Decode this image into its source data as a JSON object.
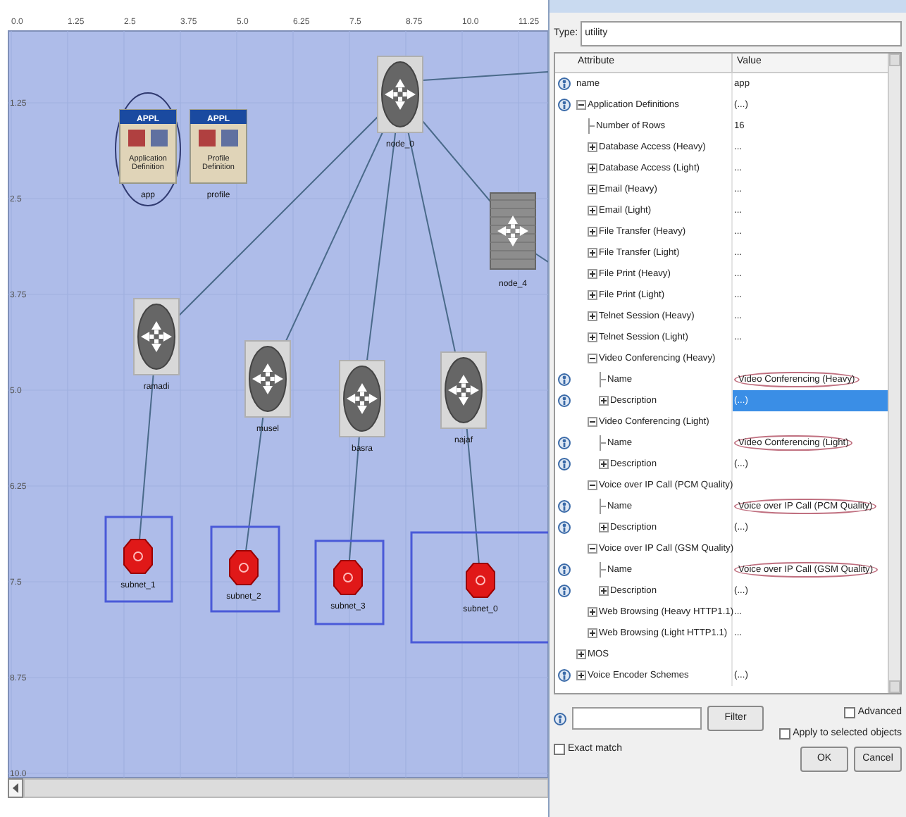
{
  "canvas": {
    "x_ruler": [
      "0.0",
      "1.25",
      "2.5",
      "3.75",
      "5.0",
      "6.25",
      "7.5",
      "8.75",
      "10.0",
      "11.25"
    ],
    "y_ruler": [
      "1.25",
      "2.5",
      "3.75",
      "5.0",
      "6.25",
      "7.5",
      "8.75",
      "10.0"
    ],
    "nodes": [
      {
        "kind": "config",
        "badge": "APPL",
        "caption": "Application Definition",
        "label": "app",
        "circled": true
      },
      {
        "kind": "config",
        "badge": "APPL",
        "caption": "Profile Definition",
        "label": "profile",
        "circled": false
      },
      {
        "kind": "router",
        "label": "node_0"
      },
      {
        "kind": "switch",
        "label": "node_4"
      },
      {
        "kind": "router",
        "label": "ramadi"
      },
      {
        "kind": "router",
        "label": "musel"
      },
      {
        "kind": "router",
        "label": "basra"
      },
      {
        "kind": "router",
        "label": "najaf"
      },
      {
        "kind": "subnet",
        "label": "subnet_1"
      },
      {
        "kind": "subnet",
        "label": "subnet_2"
      },
      {
        "kind": "subnet",
        "label": "subnet_3"
      },
      {
        "kind": "subnet",
        "label": "subnet_0"
      }
    ]
  },
  "dialog": {
    "type_label": "Type:",
    "type_value": "utility",
    "columns": [
      "Attribute",
      "Value"
    ],
    "attributes": [
      {
        "name": "name",
        "value": "app",
        "info": true,
        "selected": false
      },
      {
        "name": "Application Definitions",
        "value": "(...)",
        "info": true,
        "expanded": true,
        "selected": false,
        "children": [
          {
            "name": "Number of Rows",
            "value": "16",
            "info": false,
            "selected": false
          },
          {
            "name": "Database Access (Heavy)",
            "value": "...",
            "info": false,
            "expanded": false,
            "selected": false
          },
          {
            "name": "Database Access (Light)",
            "value": "...",
            "info": false,
            "expanded": false,
            "selected": false
          },
          {
            "name": "Email (Heavy)",
            "value": "...",
            "info": false,
            "expanded": false,
            "selected": false
          },
          {
            "name": "Email (Light)",
            "value": "...",
            "info": false,
            "expanded": false,
            "selected": false
          },
          {
            "name": "File Transfer (Heavy)",
            "value": "...",
            "info": false,
            "expanded": false,
            "selected": false
          },
          {
            "name": "File Transfer (Light)",
            "value": "...",
            "info": false,
            "expanded": false,
            "selected": false
          },
          {
            "name": "File Print (Heavy)",
            "value": "...",
            "info": false,
            "expanded": false,
            "selected": false
          },
          {
            "name": "File Print (Light)",
            "value": "...",
            "info": false,
            "expanded": false,
            "selected": false
          },
          {
            "name": "Telnet Session (Heavy)",
            "value": "...",
            "info": false,
            "expanded": false,
            "selected": false
          },
          {
            "name": "Telnet Session (Light)",
            "value": "...",
            "info": false,
            "expanded": false,
            "selected": false
          },
          {
            "name": "Video Conferencing (Heavy)",
            "info": false,
            "expanded": true,
            "selected": false,
            "children": [
              {
                "name": "Name",
                "value": "Video Conferencing (Heavy)",
                "circled": true,
                "info": true,
                "selected": false
              },
              {
                "name": "Description",
                "value": "(...)",
                "info": true,
                "expanded": false,
                "selected": true
              }
            ]
          },
          {
            "name": "Video Conferencing (Light)",
            "info": false,
            "expanded": true,
            "selected": false,
            "children": [
              {
                "name": "Name",
                "value": "Video Conferencing (Light)",
                "circled": true,
                "info": true,
                "selected": false
              },
              {
                "name": "Description",
                "value": "(...)",
                "info": true,
                "expanded": false,
                "selected": false
              }
            ]
          },
          {
            "name": "Voice over IP Call (PCM Quality)",
            "info": false,
            "expanded": true,
            "selected": false,
            "children": [
              {
                "name": "Name",
                "value": "Voice over IP Call (PCM Quality)",
                "circled": true,
                "info": true,
                "selected": false
              },
              {
                "name": "Description",
                "value": "(...)",
                "info": true,
                "expanded": false,
                "selected": false
              }
            ]
          },
          {
            "name": "Voice over IP Call (GSM Quality)",
            "info": false,
            "expanded": true,
            "selected": false,
            "children": [
              {
                "name": "Name",
                "value": "Voice over IP Call (GSM Quality)",
                "circled": true,
                "info": true,
                "selected": false
              },
              {
                "name": "Description",
                "value": "(...)",
                "info": true,
                "expanded": false,
                "selected": false
              }
            ]
          },
          {
            "name": "Web Browsing (Heavy HTTP1.1)",
            "value": "...",
            "info": false,
            "expanded": false,
            "selected": false
          },
          {
            "name": "Web Browsing (Light HTTP1.1)",
            "value": "...",
            "info": false,
            "expanded": false,
            "selected": false
          }
        ]
      },
      {
        "name": "MOS",
        "info": false,
        "expanded": false,
        "selected": false
      },
      {
        "name": "Voice Encoder Schemes",
        "value": "(...)",
        "info": true,
        "expanded": false,
        "selected": false
      }
    ],
    "filter_button": "Filter",
    "exact_match": {
      "label": "Exact match",
      "checked": false
    },
    "advanced": {
      "label": "Advanced",
      "checked": false
    },
    "apply_selected": {
      "label": "Apply to selected objects",
      "checked": false
    },
    "buttons": [
      "OK",
      "Cancel"
    ]
  }
}
